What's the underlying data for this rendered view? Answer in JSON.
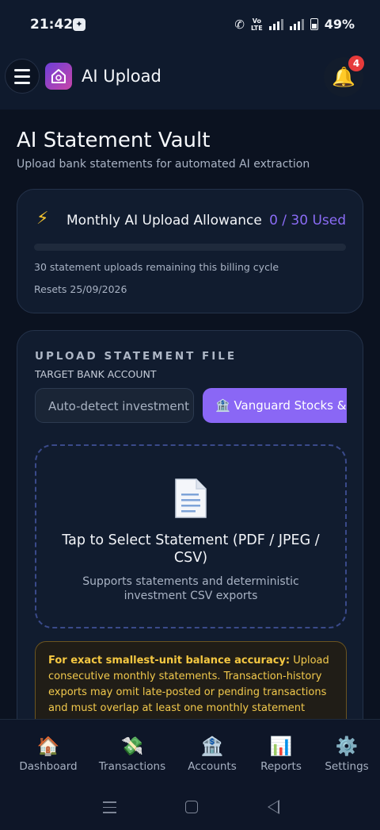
{
  "status_bar": {
    "time": "21:42",
    "volte_line1": "Vo",
    "volte_line2": "LTE",
    "battery_pct": "49%"
  },
  "header": {
    "title": "AI Upload",
    "notification_count": "4"
  },
  "page": {
    "title": "AI Statement Vault",
    "subtitle": "Upload bank statements for automated AI extraction"
  },
  "allowance": {
    "icon": "lightning-icon",
    "title": "Monthly AI Upload Allowance",
    "used_text": "0 / 30 Used",
    "used_fraction": 0,
    "remaining_text": "30 statement uploads remaining this billing cycle",
    "reset_text": "Resets 25/09/2026"
  },
  "upload": {
    "heading": "UPLOAD STATEMENT FILE",
    "target_label": "TARGET BANK ACCOUNT",
    "accounts": [
      {
        "label": "Auto-detect investment",
        "selected": false
      },
      {
        "label": "🏦 Vanguard Stocks &",
        "selected": true
      }
    ],
    "drop_title": "Tap to Select Statement (PDF / JPEG / CSV)",
    "drop_subtitle": "Supports statements and deterministic investment CSV exports",
    "warning_bold": "For exact smallest-unit balance accuracy:",
    "warning_text": " Upload consecutive monthly statements. Transaction-history exports may omit late-posted or pending transactions and must overlap at least one monthly statement containing opening"
  },
  "bottom_nav": {
    "items": [
      {
        "label": "Dashboard",
        "icon": "🏠"
      },
      {
        "label": "Transactions",
        "icon": "💸"
      },
      {
        "label": "Accounts",
        "icon": "🏦"
      },
      {
        "label": "Reports",
        "icon": "📊"
      },
      {
        "label": "Settings",
        "icon": "⚙️"
      }
    ]
  },
  "colors": {
    "accent": "#8b6cf6",
    "background": "#0b1220",
    "warning": "#f2c94c",
    "badge": "#e63b3b"
  }
}
